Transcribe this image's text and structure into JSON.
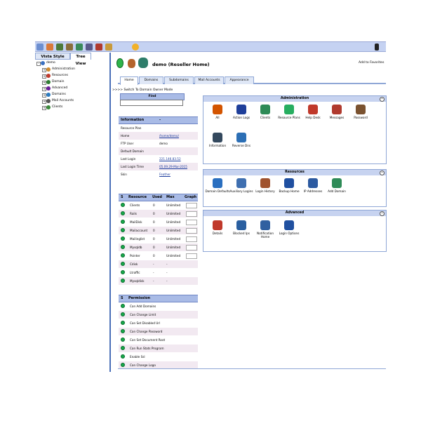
{
  "left_tabs": [
    "Vista Style",
    "Tree View"
  ],
  "tree": [
    {
      "label": "demo",
      "color": "#3a70c0"
    },
    {
      "label": "Administration",
      "color": "#d08a2a"
    },
    {
      "label": "Resources",
      "color": "#c0392b"
    },
    {
      "label": "Domain",
      "color": "#2e7d32"
    },
    {
      "label": "Advanced",
      "color": "#6a1b9a"
    },
    {
      "label": "Domains",
      "color": "#2a7ac0"
    },
    {
      "label": "Mail Accounts",
      "color": "#555555"
    },
    {
      "label": "Clients",
      "color": "#3a8a3a"
    }
  ],
  "header": {
    "title": "demo (Reseller Home)",
    "favorites": "Add to Favorites"
  },
  "tabs": [
    "Home",
    "Domains",
    "Subdomains",
    "Mail Accounts",
    "Appearance"
  ],
  "switch_link": ">>>> Switch To Domain Owner Mode",
  "find": {
    "label": "Find"
  },
  "information": {
    "title": "Information",
    "title_value": "-",
    "rows": [
      {
        "label": "Resource Plan",
        "value": ""
      },
      {
        "label": "Home",
        "value": "/home/demo/"
      },
      {
        "label": "FTP User",
        "value": "demo"
      },
      {
        "label": "Default Domain",
        "value": ""
      },
      {
        "label": "Last Login",
        "value": "221.146.83.52"
      },
      {
        "label": "Last Login Time",
        "value": "05.09.29-Mar-2015"
      },
      {
        "label": "Skin",
        "value": "Feather"
      }
    ]
  },
  "resources": {
    "headers": [
      "S",
      "Resource",
      "Used",
      "Max",
      "Graph"
    ],
    "rows": [
      {
        "name": "Clients",
        "used": "0",
        "max": "Unlimited"
      },
      {
        "name": "Rails",
        "used": "0",
        "max": "Unlimited"
      },
      {
        "name": "MailDisk",
        "used": "0",
        "max": "Unlimited"
      },
      {
        "name": "Mailaccount",
        "used": "0",
        "max": "Unlimited"
      },
      {
        "name": "Mailinglist",
        "used": "0",
        "max": "Unlimited"
      },
      {
        "name": "Mysqldb",
        "used": "0",
        "max": "Unlimited"
      },
      {
        "name": "Pointer",
        "used": "0",
        "max": "Unlimited"
      },
      {
        "name": "Cdisk",
        "used": "-",
        "max": "-"
      },
      {
        "name": "Ltraffic",
        "used": "-",
        "max": "-"
      },
      {
        "name": "Mysqldisk",
        "used": "-",
        "max": "-"
      }
    ]
  },
  "permissions": {
    "headers": [
      "S",
      "Permission"
    ],
    "rows": [
      "Can Add Domains",
      "Can Change Limit",
      "Can Set Disabled Url",
      "Can Change Password",
      "Can Set Document Root",
      "Can Run Stats Program",
      "Enable Ssl",
      "Can Change Logo"
    ]
  },
  "admin_panel": {
    "title": "Administration",
    "items": [
      {
        "label": "All",
        "color": "#d35400"
      },
      {
        "label": "Action Logs",
        "color": "#1f3f9a"
      },
      {
        "label": "Clients",
        "color": "#2e8b57"
      },
      {
        "label": "Resource Plans",
        "color": "#27ae60"
      },
      {
        "label": "Help Desk",
        "color": "#c0392b"
      },
      {
        "label": "Messages",
        "color": "#b03a2e"
      },
      {
        "label": "Password",
        "color": "#7a5230"
      },
      {
        "label": "Information",
        "color": "#34495e"
      },
      {
        "label": "Reverse Dns",
        "color": "#2c6fb5"
      }
    ]
  },
  "resources_panel": {
    "title": "Resources",
    "items": [
      {
        "label": "Domain Defaults",
        "color": "#2a6fc0"
      },
      {
        "label": "Auxiliary Logins",
        "color": "#3f6fb0"
      },
      {
        "label": "Login History",
        "color": "#a0522d"
      },
      {
        "label": "Backup Home",
        "color": "#1f4fa0"
      },
      {
        "label": "IP Addresses",
        "color": "#2c5aa0"
      },
      {
        "label": "Add Domain",
        "color": "#2e8b57"
      }
    ]
  },
  "advanced_panel": {
    "title": "Advanced",
    "items": [
      {
        "label": "Details",
        "color": "#c0392b"
      },
      {
        "label": "Blocked Ips",
        "color": "#2a5fa0"
      },
      {
        "label": "Notification Home",
        "color": "#3060a0"
      },
      {
        "label": "Login Options",
        "color": "#2050a0"
      }
    ]
  },
  "colors": {
    "toolbar": "#c5d2f2",
    "header": "#a9bbe6",
    "accent": "#4a6fb8",
    "status_green": "#17a84a"
  }
}
